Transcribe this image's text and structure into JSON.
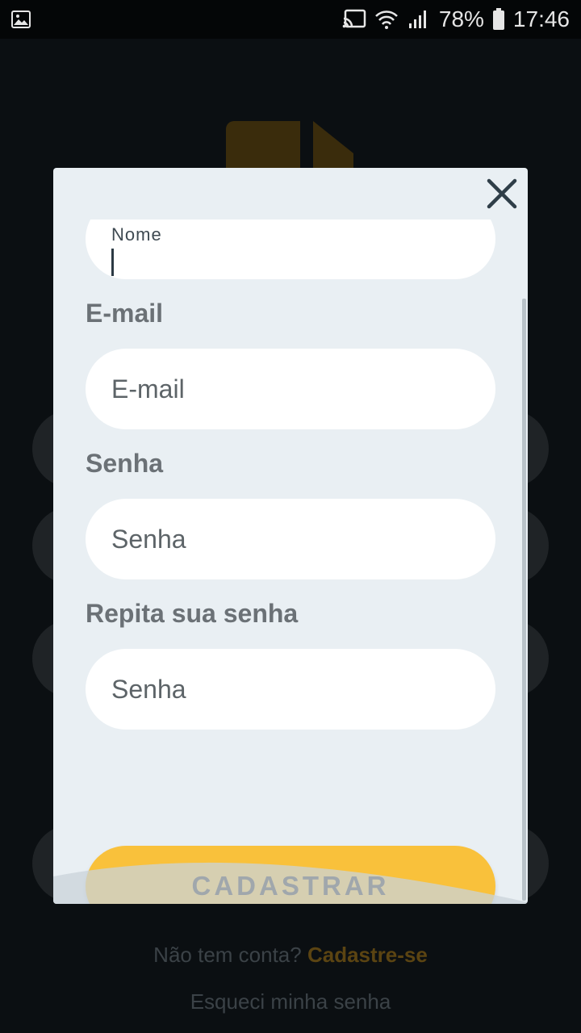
{
  "status_bar": {
    "battery_percent": "78%",
    "time": "17:46"
  },
  "background": {
    "footer": {
      "prompt": "Não tem conta?",
      "signup_link": "Cadastre-se",
      "forgot_link": "Esqueci minha senha"
    }
  },
  "modal": {
    "fields": {
      "nome": {
        "label": "Nome",
        "value": ""
      },
      "email": {
        "label": "E-mail",
        "placeholder": "E-mail"
      },
      "senha": {
        "label": "Senha",
        "placeholder": "Senha"
      },
      "repita": {
        "label": "Repita sua senha",
        "placeholder": "Senha"
      }
    },
    "submit_label": "CADASTRAR"
  },
  "colors": {
    "accent": "#f9c13b",
    "modal_bg": "#e9eff3",
    "label": "#6b7176"
  }
}
